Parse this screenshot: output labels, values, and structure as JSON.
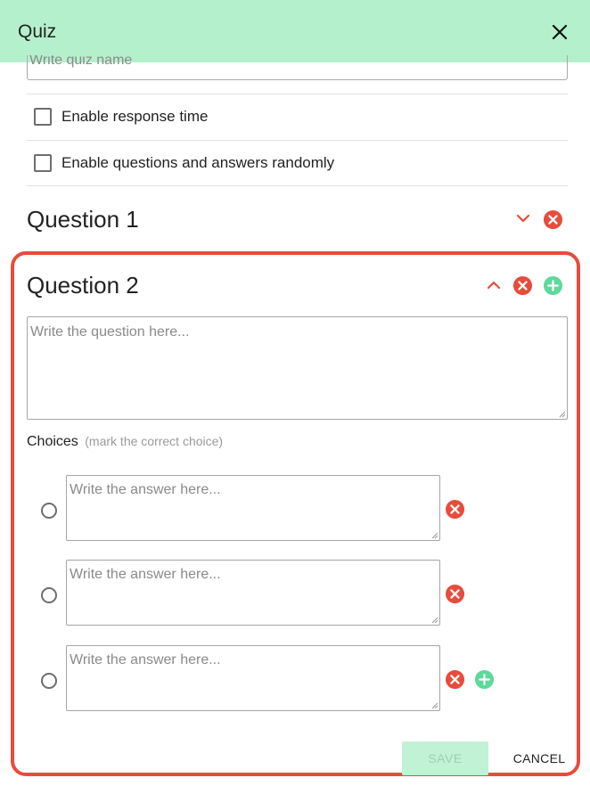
{
  "dialog": {
    "title": "Quiz"
  },
  "quiz_name": {
    "placeholder": "Write quiz name"
  },
  "options": [
    {
      "label": "Enable response time",
      "checked": false
    },
    {
      "label": "Enable questions and answers randomly",
      "checked": false
    }
  ],
  "questions": [
    {
      "title": "Question 1",
      "expanded": false
    },
    {
      "title": "Question 2",
      "expanded": true,
      "question_placeholder": "Write the question here...",
      "choices_label": "Choices",
      "choices_hint": "(mark the correct choice)",
      "answers": [
        {
          "placeholder": "Write the answer here...",
          "selected": false
        },
        {
          "placeholder": "Write the answer here...",
          "selected": false
        },
        {
          "placeholder": "Write the answer here...",
          "selected": false
        }
      ]
    }
  ],
  "actions": {
    "save_label": "SAVE",
    "cancel_label": "CANCEL"
  },
  "colors": {
    "header": "#b5f0cd",
    "delete": "#e74c3c",
    "add": "#5dd99a",
    "highlight": "#e74c3c",
    "save_disabled": "#c2f2d6"
  },
  "icons": {
    "close": "close-icon",
    "collapse": "chevron-up-icon",
    "expand": "chevron-down-icon",
    "delete": "remove-circle-icon",
    "add": "add-circle-icon"
  }
}
